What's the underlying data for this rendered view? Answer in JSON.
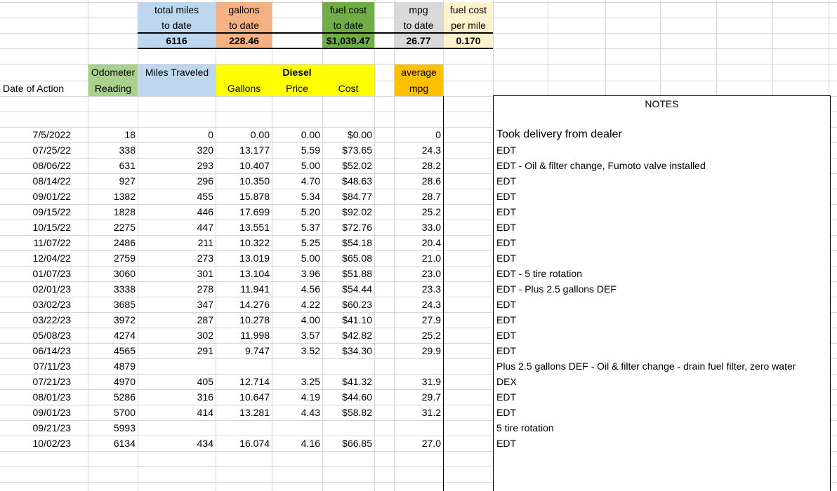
{
  "summary": {
    "total_miles": {
      "label1": "total miles",
      "label2": "to date",
      "value": "6116"
    },
    "gallons": {
      "label1": "gallons",
      "label2": "to date",
      "value": "228.46"
    },
    "fuel_cost": {
      "label1": "fuel cost",
      "label2": "to date",
      "value": "$1,039.47"
    },
    "mpg": {
      "label1": "mpg",
      "label2": "to date",
      "value": "26.77"
    },
    "cost_per_mile": {
      "label1": "fuel cost",
      "label2": "per mile",
      "value": "0.170"
    }
  },
  "headers": {
    "date": "Date of Action",
    "odometer1": "Odometer",
    "odometer2": "Reading",
    "miles": "Miles Traveled",
    "diesel": "Diesel",
    "gallons": "Gallons",
    "price": "Price",
    "cost": "Cost",
    "avg1": "average",
    "avg2": "mpg",
    "notes": "NOTES"
  },
  "rows": [
    {
      "date": "7/5/2022",
      "odo": "18",
      "miles": "0",
      "gal": "0.00",
      "price": "0.00",
      "cost": "$0.00",
      "mpg": "0",
      "note": "Took delivery from dealer"
    },
    {
      "date": "07/25/22",
      "odo": "338",
      "miles": "320",
      "gal": "13.177",
      "price": "5.59",
      "cost": "$73.65",
      "mpg": "24.3",
      "note": "EDT"
    },
    {
      "date": "08/06/22",
      "odo": "631",
      "miles": "293",
      "gal": "10.407",
      "price": "5.00",
      "cost": "$52.02",
      "mpg": "28.2",
      "note": "EDT - Oil & filter change, Fumoto valve installed"
    },
    {
      "date": "08/14/22",
      "odo": "927",
      "miles": "296",
      "gal": "10.350",
      "price": "4.70",
      "cost": "$48.63",
      "mpg": "28.6",
      "note": "EDT"
    },
    {
      "date": "09/01/22",
      "odo": "1382",
      "miles": "455",
      "gal": "15.878",
      "price": "5.34",
      "cost": "$84.77",
      "mpg": "28.7",
      "note": "EDT"
    },
    {
      "date": "09/15/22",
      "odo": "1828",
      "miles": "446",
      "gal": "17.699",
      "price": "5.20",
      "cost": "$92.02",
      "mpg": "25.2",
      "note": "EDT"
    },
    {
      "date": "10/15/22",
      "odo": "2275",
      "miles": "447",
      "gal": "13.551",
      "price": "5.37",
      "cost": "$72.76",
      "mpg": "33.0",
      "note": "EDT"
    },
    {
      "date": "11/07/22",
      "odo": "2486",
      "miles": "211",
      "gal": "10.322",
      "price": "5.25",
      "cost": "$54.18",
      "mpg": "20.4",
      "note": "EDT"
    },
    {
      "date": "12/04/22",
      "odo": "2759",
      "miles": "273",
      "gal": "13.019",
      "price": "5.00",
      "cost": "$65.08",
      "mpg": "21.0",
      "note": "EDT"
    },
    {
      "date": "01/07/23",
      "odo": "3060",
      "miles": "301",
      "gal": "13.104",
      "price": "3.96",
      "cost": "$51.88",
      "mpg": "23.0",
      "note": "EDT - 5 tire rotation"
    },
    {
      "date": "02/01/23",
      "odo": "3338",
      "miles": "278",
      "gal": "11.941",
      "price": "4.56",
      "cost": "$54.44",
      "mpg": "23.3",
      "note": "EDT - Plus 2.5 gallons DEF"
    },
    {
      "date": "03/02/23",
      "odo": "3685",
      "miles": "347",
      "gal": "14.276",
      "price": "4.22",
      "cost": "$60.23",
      "mpg": "24.3",
      "note": "EDT"
    },
    {
      "date": "03/22/23",
      "odo": "3972",
      "miles": "287",
      "gal": "10.278",
      "price": "4.00",
      "cost": "$41.10",
      "mpg": "27.9",
      "note": "EDT"
    },
    {
      "date": "05/08/23",
      "odo": "4274",
      "miles": "302",
      "gal": "11.998",
      "price": "3.57",
      "cost": "$42.82",
      "mpg": "25.2",
      "note": "EDT"
    },
    {
      "date": "06/14/23",
      "odo": "4565",
      "miles": "291",
      "gal": "9.747",
      "price": "3.52",
      "cost": "$34.30",
      "mpg": "29.9",
      "note": "EDT"
    },
    {
      "date": "07/11/23",
      "odo": "4879",
      "miles": "",
      "gal": "",
      "price": "",
      "cost": "",
      "mpg": "",
      "note": "Plus 2.5 gallons DEF - Oil & filter change - drain fuel filter, zero water"
    },
    {
      "date": "07/21/23",
      "odo": "4970",
      "miles": "405",
      "gal": "12.714",
      "price": "3.25",
      "cost": "$41.32",
      "mpg": "31.9",
      "note": "DEX"
    },
    {
      "date": "08/01/23",
      "odo": "5286",
      "miles": "316",
      "gal": "10.647",
      "price": "4.19",
      "cost": "$44.60",
      "mpg": "29.7",
      "note": "EDT"
    },
    {
      "date": "09/01/23",
      "odo": "5700",
      "miles": "414",
      "gal": "13.281",
      "price": "4.43",
      "cost": "$58.82",
      "mpg": "31.2",
      "note": "EDT"
    },
    {
      "date": "09/21/23",
      "odo": "5993",
      "miles": "",
      "gal": "",
      "price": "",
      "cost": "",
      "mpg": "",
      "note": "5 tire rotation"
    },
    {
      "date": "10/02/23",
      "odo": "6134",
      "miles": "434",
      "gal": "16.074",
      "price": "4.16",
      "cost": "$66.85",
      "mpg": "27.0",
      "note": "EDT"
    }
  ]
}
